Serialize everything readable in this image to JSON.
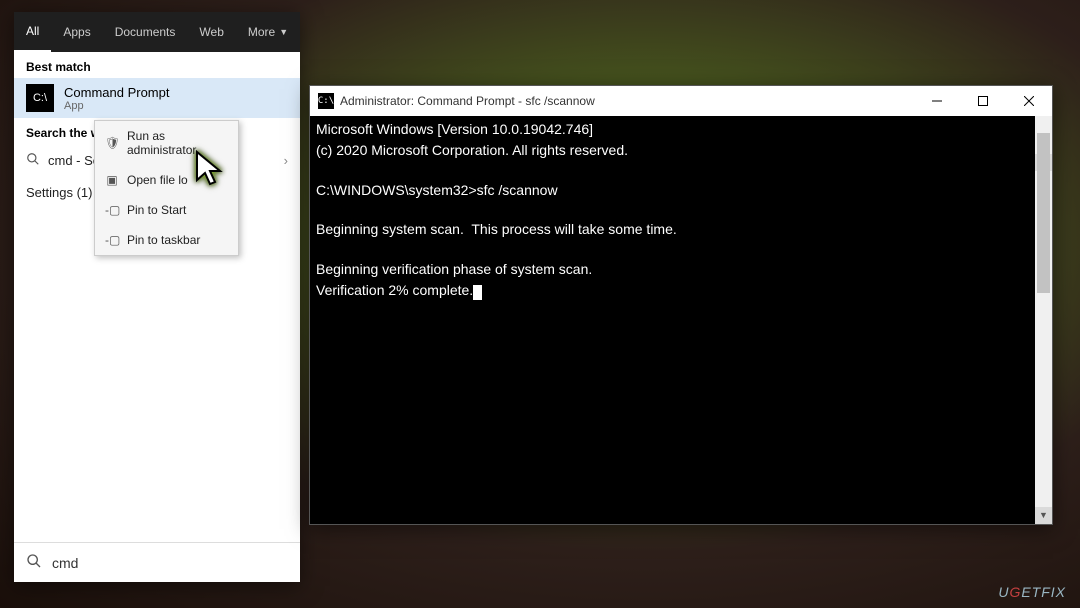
{
  "tabs": {
    "all": "All",
    "apps": "Apps",
    "documents": "Documents",
    "web": "Web",
    "more": "More"
  },
  "sections": {
    "best_match": "Best match",
    "search_web": "Search the web",
    "settings": "Settings (1)"
  },
  "result": {
    "title": "Command Prompt",
    "subtitle": "App"
  },
  "web_item": {
    "query": "cmd",
    "suffix": " - Se"
  },
  "context_menu": {
    "run_admin": "Run as administrator",
    "open_location": "Open file lo",
    "pin_start": "Pin to Start",
    "pin_taskbar": "Pin to taskbar"
  },
  "search_input": {
    "value": "cmd"
  },
  "cmd": {
    "title": "Administrator: Command Prompt - sfc  /scannow",
    "line1": "Microsoft Windows [Version 10.0.19042.746]",
    "line2": "(c) 2020 Microsoft Corporation. All rights reserved.",
    "line3": "C:\\WINDOWS\\system32>sfc /scannow",
    "line4": "Beginning system scan.  This process will take some time.",
    "line5": "Beginning verification phase of system scan.",
    "line6": "Verification 2% complete."
  },
  "watermark": "UGETFIX"
}
